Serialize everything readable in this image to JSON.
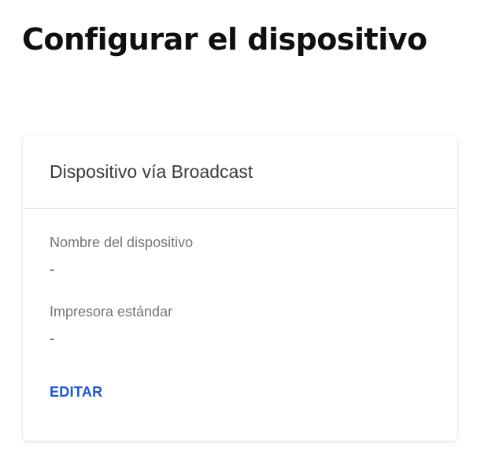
{
  "page": {
    "title": "Configurar el dispositivo"
  },
  "card": {
    "title": "Dispositivo vía Broadcast",
    "fields": [
      {
        "label": "Nombre del dispositivo",
        "value": "-"
      },
      {
        "label": "Impresora estándar",
        "value": "-"
      }
    ],
    "edit_label": "EDITAR"
  },
  "colors": {
    "accent": "#1a56db",
    "title_text": "#0f0f0f",
    "label_text": "#757575",
    "divider": "#d6d6d6"
  }
}
